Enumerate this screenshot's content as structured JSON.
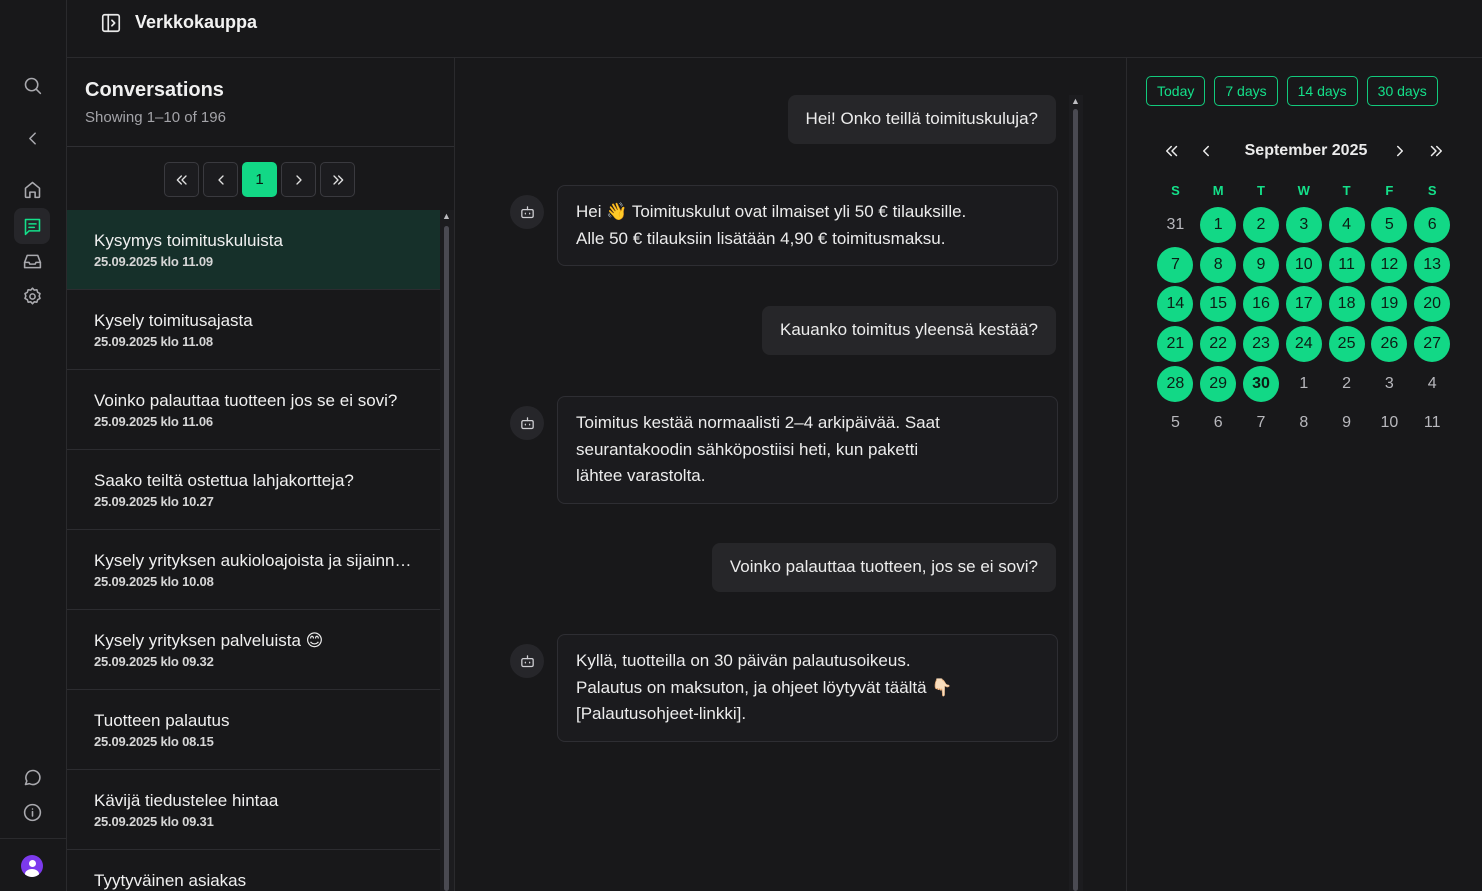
{
  "app": {
    "title": "Verkkokauppa"
  },
  "conversations": {
    "title": "Conversations",
    "subtitle": "Showing 1–10 of 196",
    "pagination": {
      "current_page": "1"
    },
    "items": [
      {
        "title": "Kysymys toimituskuluista",
        "date": "25.09.2025 klo 11.09"
      },
      {
        "title": "Kysely toimitusajasta",
        "date": "25.09.2025 klo 11.08"
      },
      {
        "title": "Voinko palauttaa tuotteen jos se ei sovi?",
        "date": "25.09.2025 klo 11.06"
      },
      {
        "title": "Saako teiltä ostettua lahjakortteja?",
        "date": "25.09.2025 klo 10.27"
      },
      {
        "title": "Kysely yrityksen aukioloajoista ja sijainnista",
        "date": "25.09.2025 klo 10.08"
      },
      {
        "title": "Kysely yrityksen palveluista 😊",
        "date": "25.09.2025 klo 09.32"
      },
      {
        "title": "Tuotteen palautus",
        "date": "25.09.2025 klo 08.15"
      },
      {
        "title": "Kävijä tiedustelee hintaa",
        "date": "25.09.2025 klo 09.31"
      },
      {
        "title": "Tyytyväinen asiakas",
        "date": ""
      }
    ]
  },
  "chat": {
    "messages": [
      {
        "role": "user",
        "text": "Hei! Onko teillä toimituskuluja?"
      },
      {
        "role": "bot",
        "lines": [
          "Hei 👋 Toimituskulut ovat ilmaiset yli 50 € tilauksille.",
          "Alle 50 € tilauksiin lisätään 4,90 € toimitusmaksu."
        ]
      },
      {
        "role": "user",
        "text": "Kauanko toimitus yleensä kestää?"
      },
      {
        "role": "bot",
        "lines": [
          "Toimitus kestää normaalisti 2–4 arkipäivää. Saat",
          "seurantakoodin sähköpostiisi heti, kun paketti",
          "lähtee varastolta."
        ]
      },
      {
        "role": "user",
        "text": "Voinko palauttaa tuotteen, jos se ei sovi?"
      },
      {
        "role": "bot",
        "lines": [
          "Kyllä, tuotteilla on 30 päivän palautusoikeus.",
          "Palautus on maksuton, ja ohjeet löytyvät täältä 👇🏻",
          "[Palautusohjeet-linkki]."
        ]
      }
    ]
  },
  "calendar": {
    "ranges": [
      "Today",
      "7 days",
      "14 days",
      "30 days"
    ],
    "month_label": "September 2025",
    "weekdays": [
      "S",
      "M",
      "T",
      "W",
      "T",
      "F",
      "S"
    ],
    "weeks": [
      [
        "31",
        "1",
        "2",
        "3",
        "4",
        "5",
        "6"
      ],
      [
        "7",
        "8",
        "9",
        "10",
        "11",
        "12",
        "13"
      ],
      [
        "14",
        "15",
        "16",
        "17",
        "18",
        "19",
        "20"
      ],
      [
        "21",
        "22",
        "23",
        "24",
        "25",
        "26",
        "27"
      ],
      [
        "28",
        "29",
        "30",
        "1",
        "2",
        "3",
        "4"
      ],
      [
        "5",
        "6",
        "7",
        "8",
        "9",
        "10",
        "11"
      ]
    ],
    "selected_range_start": "1",
    "selected_range_end": "30",
    "today": "30",
    "accent_color": "#12d886"
  },
  "colors": {
    "accent": "#12d886",
    "background": "#18181a"
  }
}
